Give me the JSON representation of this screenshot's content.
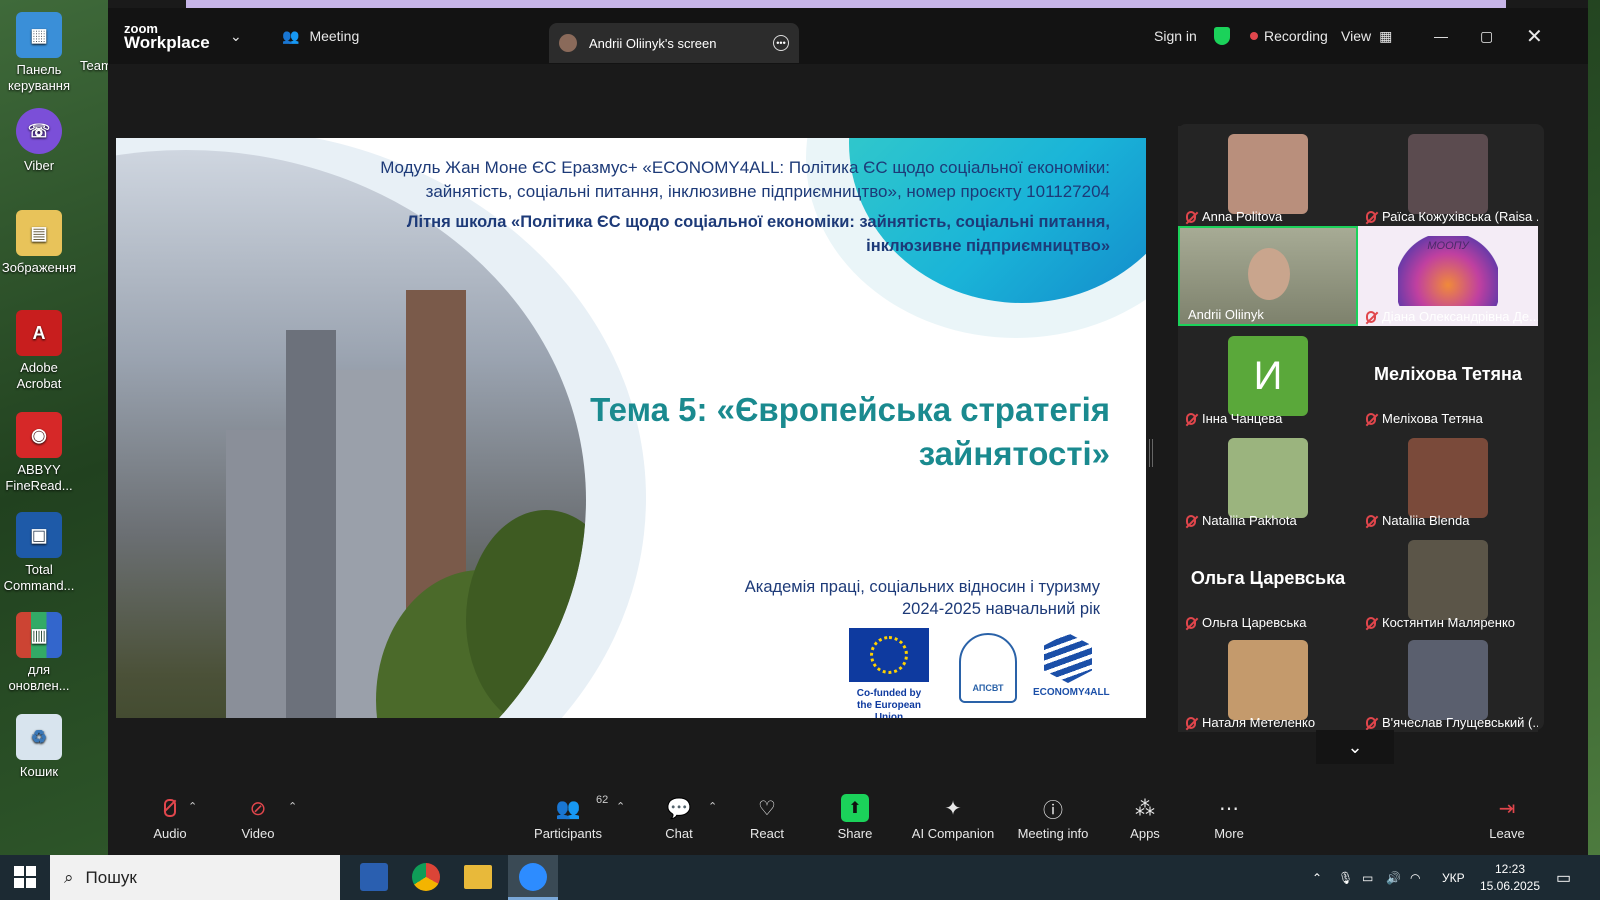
{
  "desktop": {
    "icons": [
      {
        "label": "Панель керування",
        "icon": "control-panel-icon"
      },
      {
        "label": "Viber",
        "icon": "viber-icon"
      },
      {
        "label": "Зображення",
        "icon": "pictures-folder-icon"
      },
      {
        "label": "Adobe Acrobat",
        "icon": "acrobat-icon"
      },
      {
        "label": "ABBYY FineRead...",
        "icon": "abbyy-icon"
      },
      {
        "label": "Total Command...",
        "icon": "total-commander-icon"
      },
      {
        "label": "для оновлен...",
        "icon": "archive-icon"
      },
      {
        "label": "Кошик",
        "icon": "recycle-bin-icon"
      }
    ],
    "partial_label": "Team"
  },
  "zoom": {
    "logo_top": "zoom",
    "logo_bottom": "Workplace",
    "meeting_label": "Meeting",
    "share_tab_label": "Andrii Oliinyk's screen",
    "sign_in": "Sign in",
    "recording": "Recording",
    "view": "View",
    "colors": {
      "accent_green": "#1bd25a",
      "recording_red": "#e0464c"
    }
  },
  "slide": {
    "header": "Модуль Жан Моне ЄС Еразмус+ «ECONOMY4ALL: Політика ЄС щодо соціальної економіки: зайнятість, соціальні питання, інклюзивне підприємництво», номер проєкту 101127204",
    "school": "Літня школа «Політика ЄС щодо соціальної економіки: зайнятість, соціальні питання, інклюзивне підприємництво»",
    "title": "Тема 5: «Європейська стратегія зайнятості»",
    "academy": "Академія праці, соціальних відносин і туризму",
    "year": "2024-2025 навчальний рік",
    "eu_text": "Co-funded by the European Union",
    "apsvt": "АПСВТ",
    "e4a": "ECONOMY4ALL"
  },
  "participants": [
    {
      "name": "Anna Politova",
      "type": "photo",
      "color": "#b98f7c"
    },
    {
      "name": "Раїса Кожухівська (Raisa ...",
      "type": "photo",
      "color": "#5b4b4f"
    },
    {
      "name": "Andrii Oliinyk",
      "type": "video",
      "color": "#8a8f77",
      "active": true
    },
    {
      "name": "Діана Олександрівна Де...",
      "type": "logo",
      "color": "#e8d7f0",
      "logo_text": "МООПУ"
    },
    {
      "name": "Інна Чанцева",
      "type": "initial",
      "color": "#5aa83a",
      "initial": "И"
    },
    {
      "name": "Меліхова Тетяна",
      "type": "text",
      "big": "Меліхова Тетяна"
    },
    {
      "name": "Nataliia Pakhota",
      "type": "photo",
      "color": "#9bb47e"
    },
    {
      "name": "Nataliia Blenda",
      "type": "photo",
      "color": "#7a4a3a"
    },
    {
      "name": "Ольга Царевська",
      "type": "text",
      "big": "Ольга Царевська"
    },
    {
      "name": "Костянтин  Маляренко",
      "type": "photo",
      "color": "#5b5548"
    },
    {
      "name": "Наталя Метеленко",
      "type": "photo",
      "color": "#c49a6c"
    },
    {
      "name": "В'ячеслав Глущевський (...",
      "type": "photo",
      "color": "#5a5f6e"
    }
  ],
  "toolbar": {
    "audio": "Audio",
    "video": "Video",
    "participants": "Participants",
    "participants_count": "62",
    "chat": "Chat",
    "react": "React",
    "share": "Share",
    "ai": "AI Companion",
    "info": "Meeting info",
    "apps": "Apps",
    "more": "More",
    "leave": "Leave"
  },
  "taskbar": {
    "search_placeholder": "Пошук",
    "lang": "УКР",
    "time": "12:23",
    "date": "15.06.2025"
  }
}
